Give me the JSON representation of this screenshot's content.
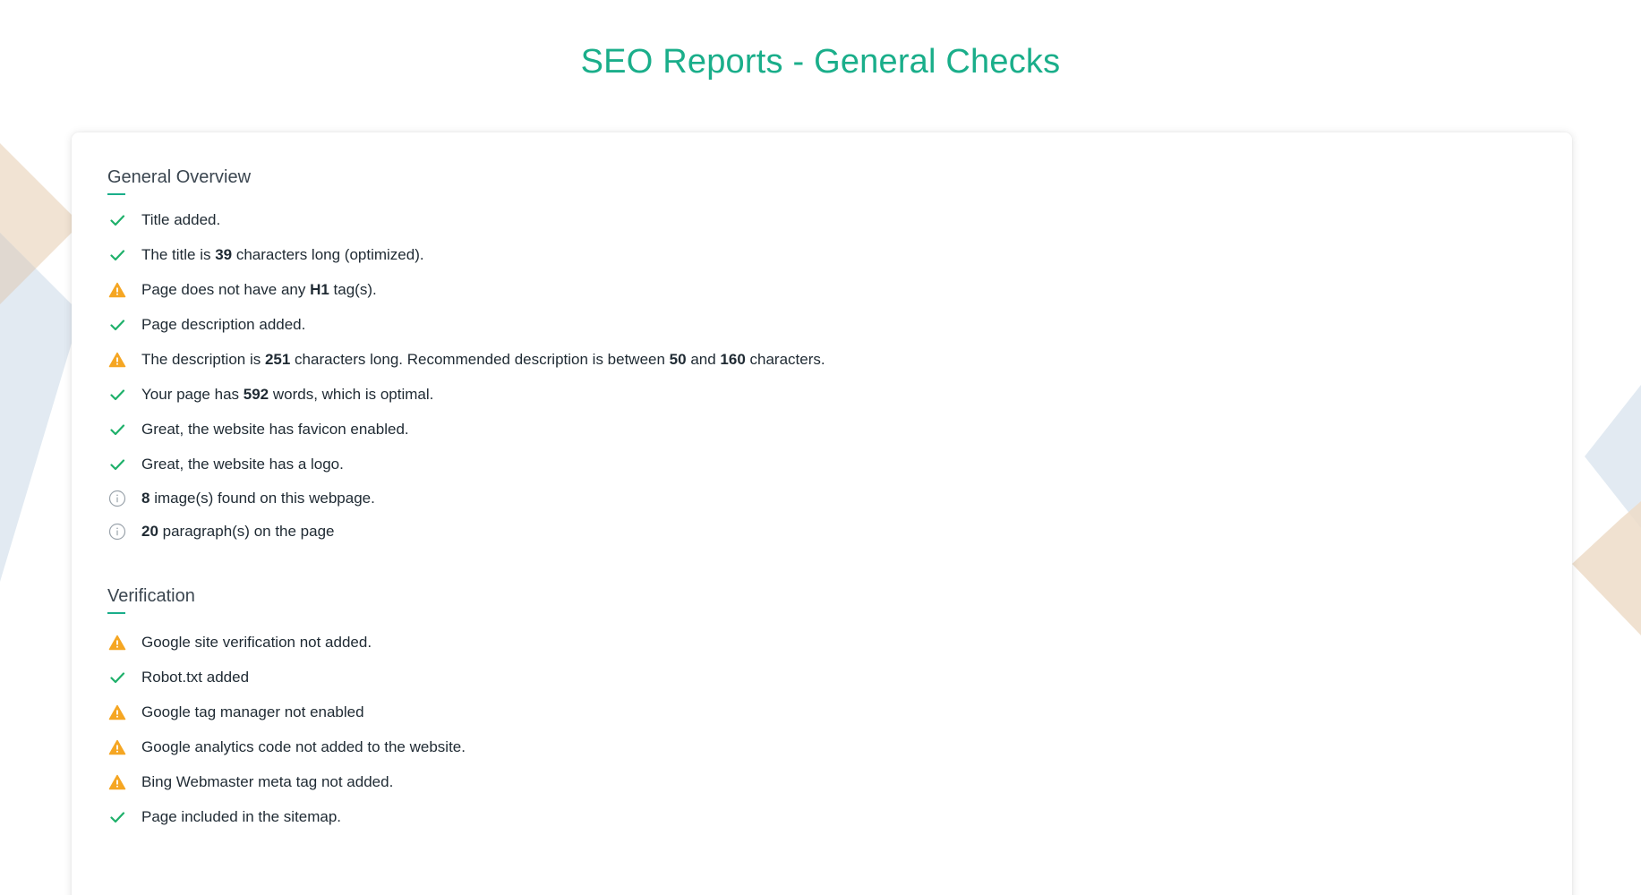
{
  "page": {
    "title": "SEO Reports - General Checks"
  },
  "colors": {
    "accent": "#1aae8a",
    "success": "#1eb06a",
    "warning": "#f5a623",
    "info": "#9aa3ab"
  },
  "icons": {
    "pass": "check-icon",
    "warning": "warning-icon",
    "info": "info-icon"
  },
  "general_overview": {
    "title": "General Overview",
    "items": [
      {
        "status": "pass",
        "parts": [
          "Title added."
        ]
      },
      {
        "status": "pass",
        "parts": [
          "The title is ",
          "39",
          " characters long (optimized)."
        ]
      },
      {
        "status": "warning",
        "parts": [
          "Page does not have any ",
          "H1",
          " tag(s)."
        ]
      },
      {
        "status": "pass",
        "parts": [
          "Page description added."
        ]
      },
      {
        "status": "warning",
        "parts": [
          "The description is ",
          "251",
          " characters long. Recommended description is between ",
          "50",
          " and ",
          "160",
          " characters."
        ]
      },
      {
        "status": "pass",
        "parts": [
          "Your page has ",
          "592",
          " words, which is optimal."
        ]
      },
      {
        "status": "pass",
        "parts": [
          "Great, the website has favicon enabled."
        ]
      },
      {
        "status": "pass",
        "parts": [
          "Great, the website has a logo."
        ]
      },
      {
        "status": "info",
        "parts": [
          "",
          "8",
          " image(s) found on this webpage."
        ]
      },
      {
        "status": "info",
        "parts": [
          "",
          "20",
          " paragraph(s) on the page"
        ]
      }
    ]
  },
  "verification": {
    "title": "Verification",
    "items": [
      {
        "status": "warning",
        "parts": [
          "Google site verification not added."
        ]
      },
      {
        "status": "pass",
        "parts": [
          "Robot.txt added"
        ]
      },
      {
        "status": "warning",
        "parts": [
          "Google tag manager not enabled"
        ]
      },
      {
        "status": "warning",
        "parts": [
          "Google analytics code not added to the website."
        ]
      },
      {
        "status": "warning",
        "parts": [
          "Bing Webmaster meta tag not added."
        ]
      },
      {
        "status": "pass",
        "parts": [
          "Page included in the sitemap."
        ]
      }
    ]
  }
}
